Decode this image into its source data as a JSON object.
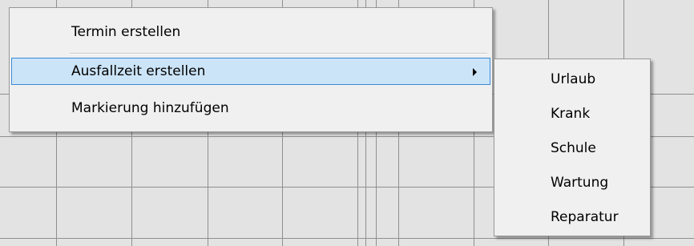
{
  "context_menu": {
    "items": [
      {
        "label": "Termin erstellen"
      },
      {
        "label": "Ausfallzeit erstellen",
        "has_submenu": true,
        "highlighted": true
      },
      {
        "label": "Markierung hinzufügen"
      }
    ]
  },
  "submenu": {
    "items": [
      {
        "label": "Urlaub"
      },
      {
        "label": "Krank"
      },
      {
        "label": "Schule"
      },
      {
        "label": "Wartung"
      },
      {
        "label": "Reparatur"
      }
    ]
  },
  "colors": {
    "menu_background": "#f0f0f0",
    "highlight_background": "#cce4f7",
    "highlight_border": "#3c8ad6",
    "grid_background": "#e3e3e3",
    "grid_lines": "#8f8f8f"
  }
}
